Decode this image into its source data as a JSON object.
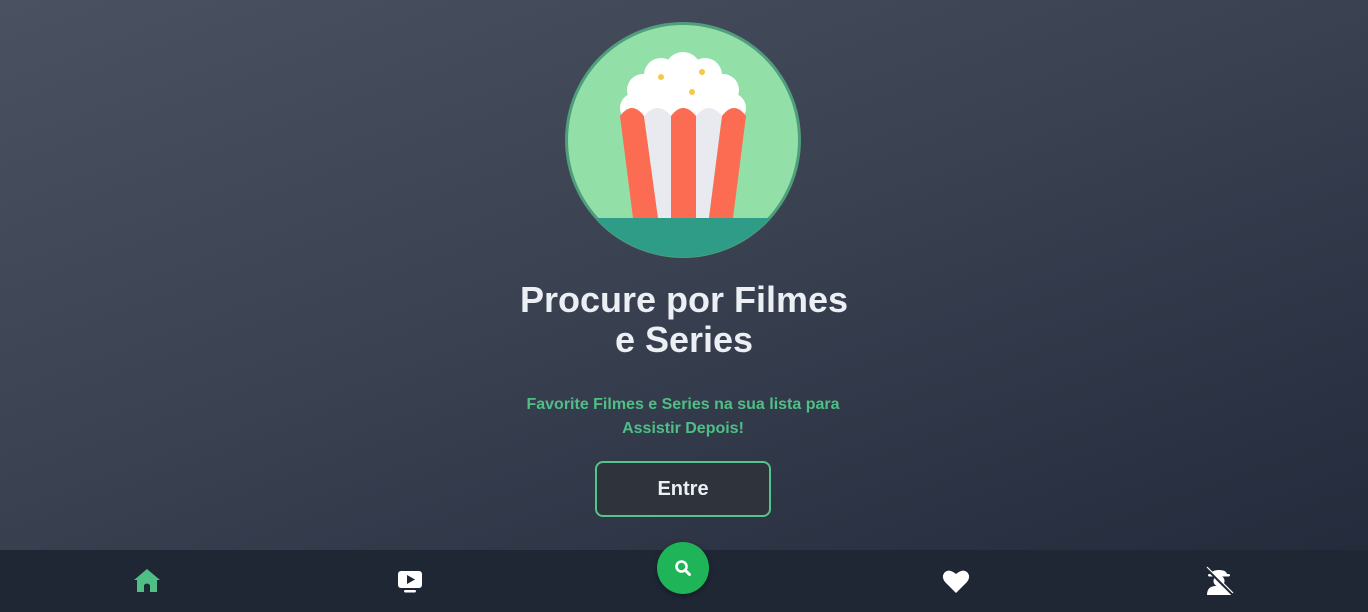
{
  "hero": {
    "logo_icon": "popcorn-icon",
    "title_line1": "Procure por Filmes",
    "title_line2": "e Series",
    "subtitle_line1": "Favorite Filmes e Series na sua lista para",
    "subtitle_line2": "Assistir Depois!",
    "enter_label": "Entre"
  },
  "navbar": {
    "items": [
      {
        "icon": "home-icon",
        "active": true
      },
      {
        "icon": "play-screen-icon",
        "active": false
      },
      {
        "icon": "search-icon",
        "active": false
      },
      {
        "icon": "heart-icon",
        "active": false
      },
      {
        "icon": "user-incognito-icon",
        "active": false
      }
    ]
  },
  "colors": {
    "accent_green": "#4fbf85",
    "fab_green": "#1fb458",
    "title_text": "#eceff3",
    "navbar_bg": "#1f2735",
    "button_bg": "#2f343c"
  }
}
